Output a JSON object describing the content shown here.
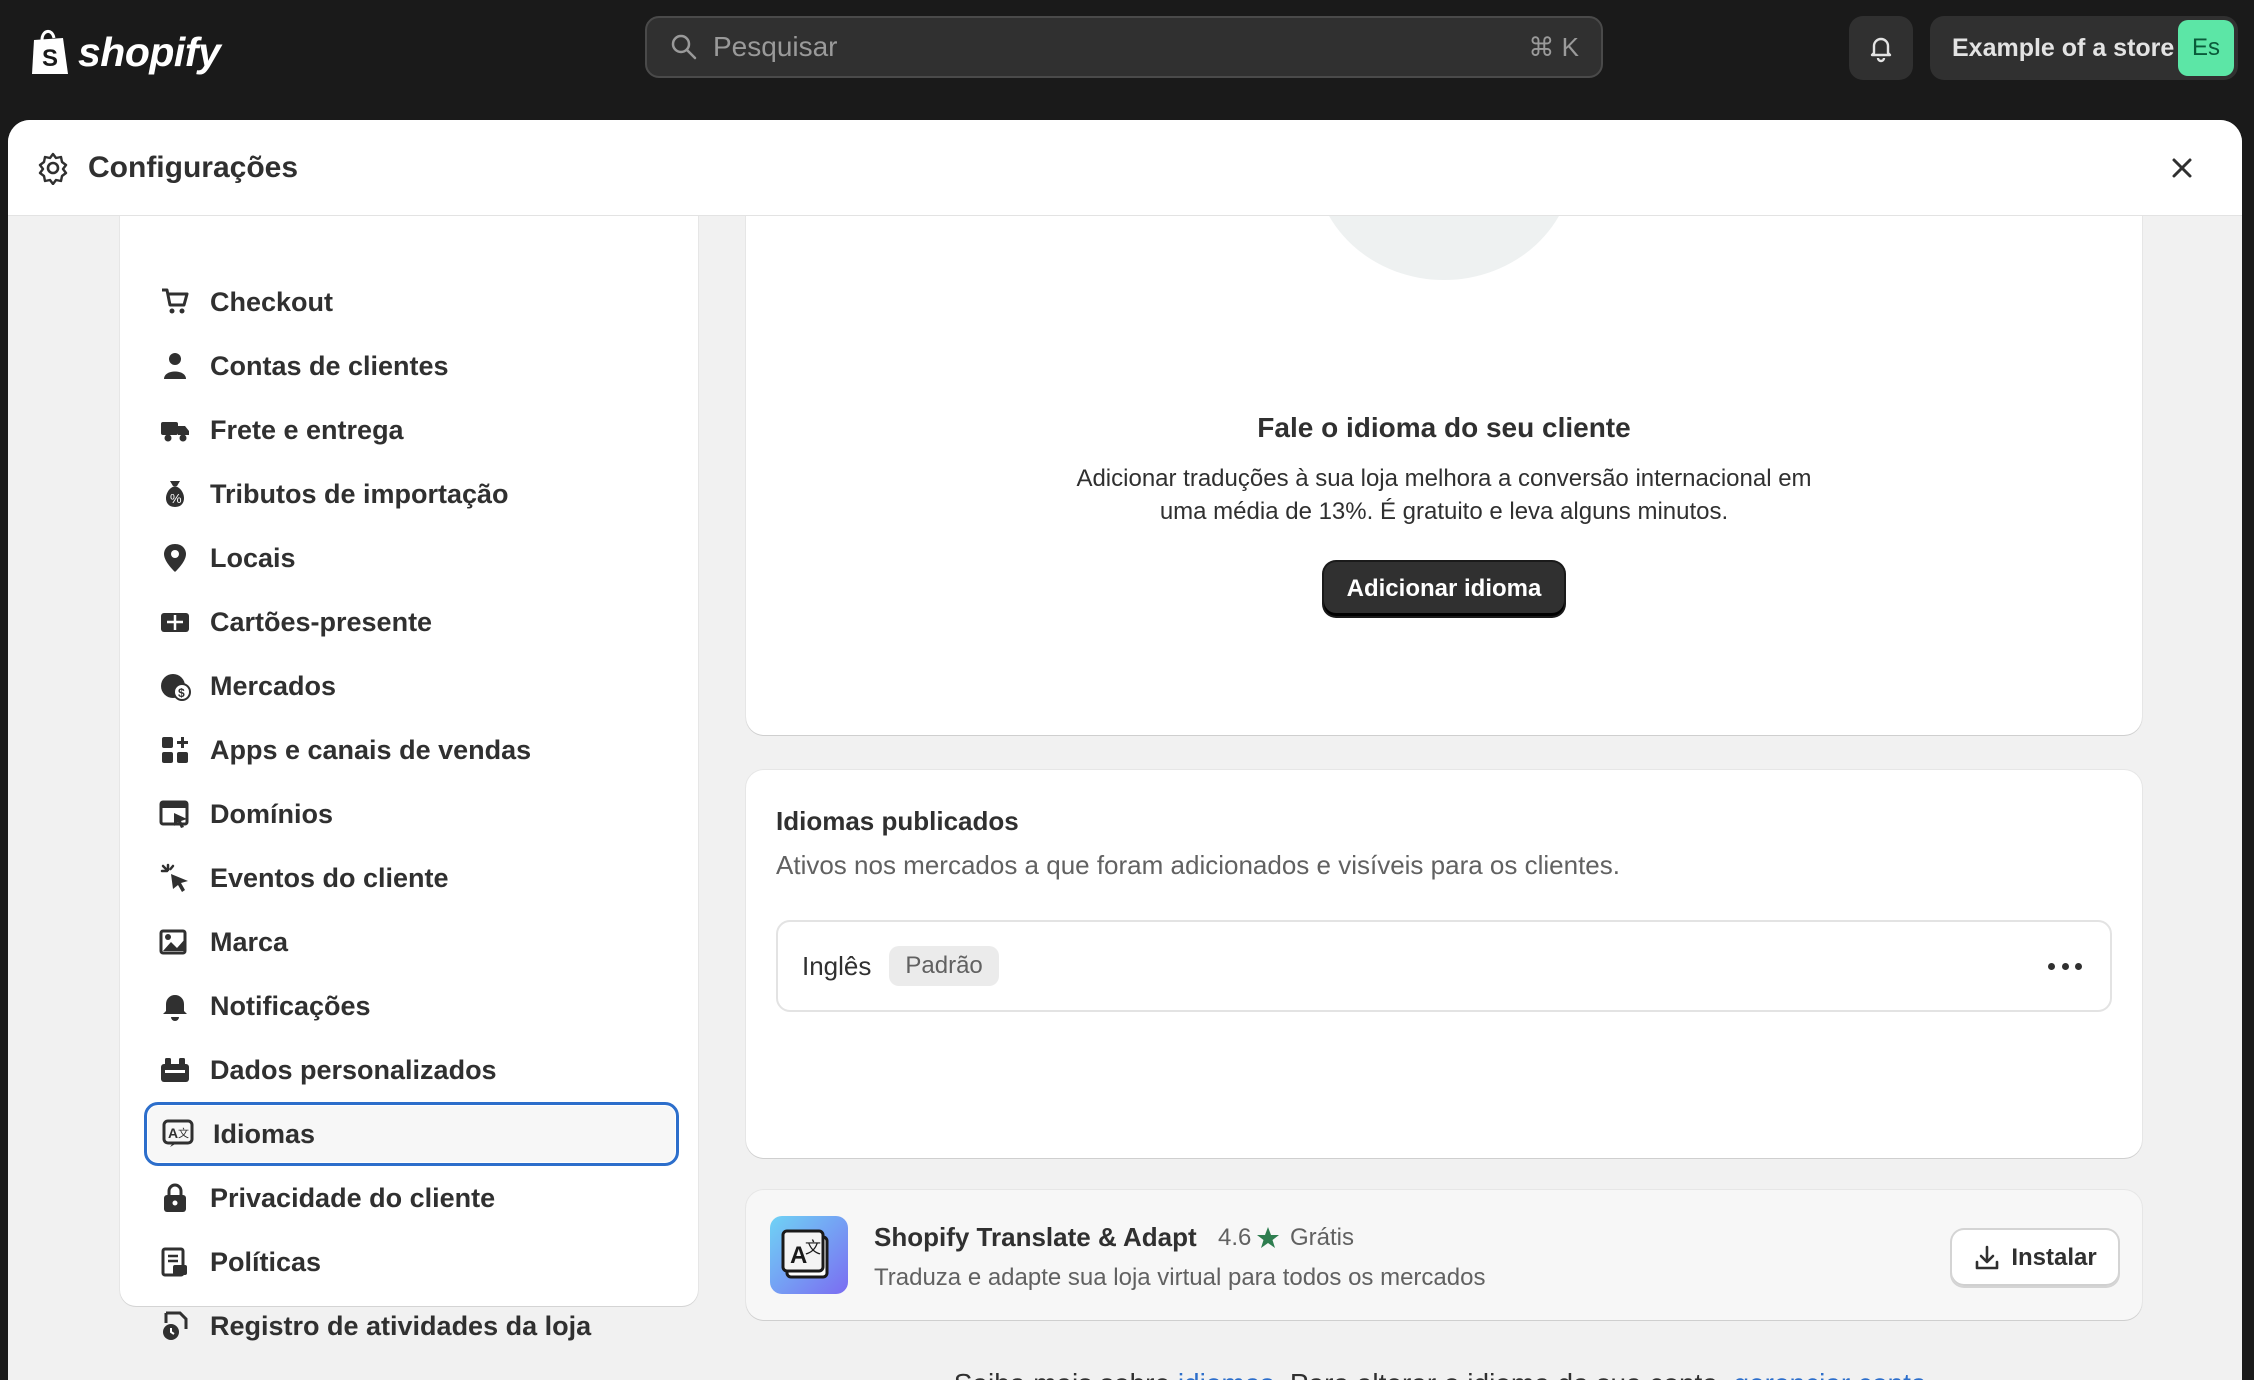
{
  "topbar": {
    "logo_text": "shopify",
    "search_placeholder": "Pesquisar",
    "search_shortcut": "⌘ K",
    "store_name": "Example of a store",
    "avatar_initials": "Es"
  },
  "modal": {
    "title": "Configurações"
  },
  "sidebar": {
    "items": [
      {
        "label": "Checkout",
        "icon": "cart-icon"
      },
      {
        "label": "Contas de clientes",
        "icon": "person-icon"
      },
      {
        "label": "Frete e entrega",
        "icon": "truck-icon"
      },
      {
        "label": "Tributos de importação",
        "icon": "money-bag-icon"
      },
      {
        "label": "Locais",
        "icon": "location-pin-icon"
      },
      {
        "label": "Cartões-presente",
        "icon": "gift-card-icon"
      },
      {
        "label": "Mercados",
        "icon": "globe-dollar-icon"
      },
      {
        "label": "Apps e canais de vendas",
        "icon": "apps-icon"
      },
      {
        "label": "Domínios",
        "icon": "domain-icon"
      },
      {
        "label": "Eventos do cliente",
        "icon": "cursor-click-icon"
      },
      {
        "label": "Marca",
        "icon": "brand-image-icon"
      },
      {
        "label": "Notificações",
        "icon": "bell-icon"
      },
      {
        "label": "Dados personalizados",
        "icon": "custom-data-icon"
      },
      {
        "label": "Idiomas",
        "icon": "translate-icon"
      },
      {
        "label": "Privacidade do cliente",
        "icon": "lock-icon"
      },
      {
        "label": "Políticas",
        "icon": "policy-icon"
      },
      {
        "label": "Registro de atividades da loja",
        "icon": "activity-log-icon"
      }
    ],
    "active_index": 13
  },
  "hero": {
    "heading": "Fale o idioma do seu cliente",
    "text_line1": "Adicionar traduções à sua loja melhora a conversão internacional em",
    "text_line2": "uma média de 13%. É gratuito e leva alguns minutos.",
    "button": "Adicionar idioma"
  },
  "published": {
    "heading": "Idiomas publicados",
    "subtitle": "Ativos nos mercados a que foram adicionados e visíveis para os clientes.",
    "language": "Inglês",
    "badge": "Padrão"
  },
  "app": {
    "name": "Shopify Translate & Adapt",
    "rating": "4.6",
    "price": "Grátis",
    "description": "Traduza e adapte sua loja virtual para todos os mercados",
    "install": "Instalar"
  },
  "footer": {
    "prefix": "Saiba mais sobre ",
    "link1": "idiomas",
    "middle": ". Para alterar o idioma da sua conta, ",
    "link2": "gerenciar conta",
    "suffix": "."
  },
  "colors": {
    "accent": "#2c6ecb",
    "topbar": "#1a1a1a",
    "avatar": "#5ce6a6",
    "star": "#2e7d4f"
  }
}
